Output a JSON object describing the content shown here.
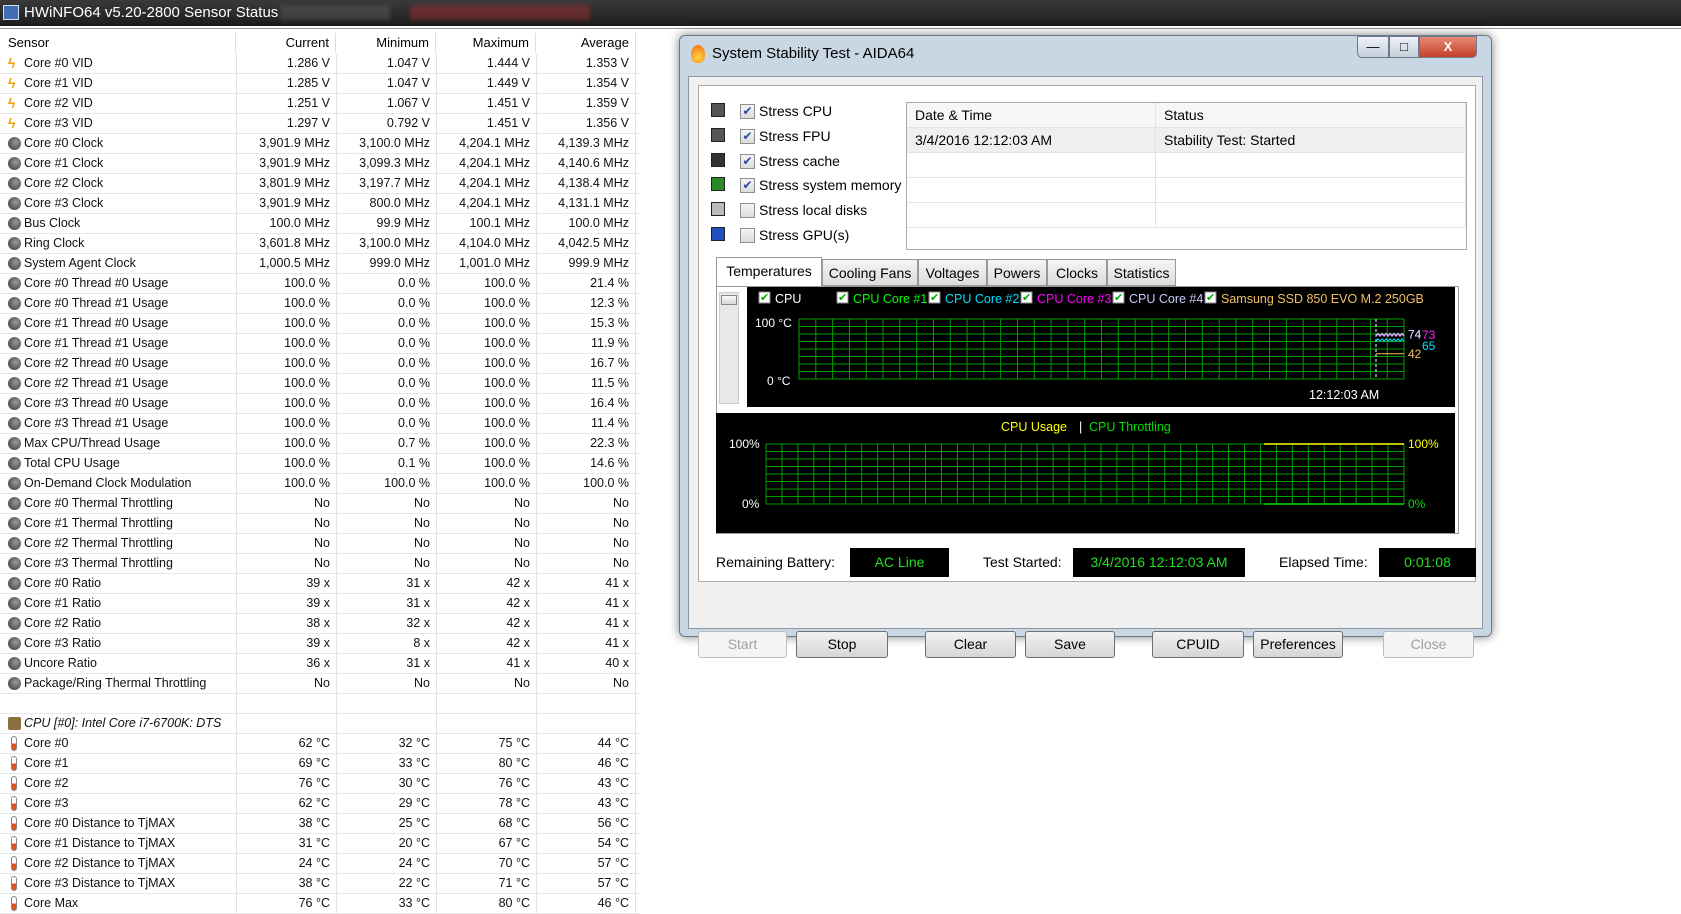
{
  "hwinfo": {
    "title": "HWiNFO64 v5.20-2800 Sensor Status",
    "columns": [
      "Sensor",
      "Current",
      "Minimum",
      "Maximum",
      "Average"
    ],
    "rows": [
      {
        "icon": "bolt",
        "name": "Core #0 VID",
        "v": [
          "1.286 V",
          "1.047 V",
          "1.444 V",
          "1.353 V"
        ]
      },
      {
        "icon": "bolt",
        "name": "Core #1 VID",
        "v": [
          "1.285 V",
          "1.047 V",
          "1.449 V",
          "1.354 V"
        ]
      },
      {
        "icon": "bolt",
        "name": "Core #2 VID",
        "v": [
          "1.251 V",
          "1.067 V",
          "1.451 V",
          "1.359 V"
        ]
      },
      {
        "icon": "bolt",
        "name": "Core #3 VID",
        "v": [
          "1.297 V",
          "0.792 V",
          "1.451 V",
          "1.356 V"
        ]
      },
      {
        "icon": "gauge",
        "name": "Core #0 Clock",
        "v": [
          "3,901.9 MHz",
          "3,100.0 MHz",
          "4,204.1 MHz",
          "4,139.3 MHz"
        ]
      },
      {
        "icon": "gauge",
        "name": "Core #1 Clock",
        "v": [
          "3,901.9 MHz",
          "3,099.3 MHz",
          "4,204.1 MHz",
          "4,140.6 MHz"
        ]
      },
      {
        "icon": "gauge",
        "name": "Core #2 Clock",
        "v": [
          "3,801.9 MHz",
          "3,197.7 MHz",
          "4,204.1 MHz",
          "4,138.4 MHz"
        ]
      },
      {
        "icon": "gauge",
        "name": "Core #3 Clock",
        "v": [
          "3,901.9 MHz",
          "800.0 MHz",
          "4,204.1 MHz",
          "4,131.1 MHz"
        ]
      },
      {
        "icon": "gauge",
        "name": "Bus Clock",
        "v": [
          "100.0 MHz",
          "99.9 MHz",
          "100.1 MHz",
          "100.0 MHz"
        ]
      },
      {
        "icon": "gauge",
        "name": "Ring Clock",
        "v": [
          "3,601.8 MHz",
          "3,100.0 MHz",
          "4,104.0 MHz",
          "4,042.5 MHz"
        ]
      },
      {
        "icon": "gauge",
        "name": "System Agent Clock",
        "v": [
          "1,000.5 MHz",
          "999.0 MHz",
          "1,001.0 MHz",
          "999.9 MHz"
        ]
      },
      {
        "icon": "gauge",
        "name": "Core #0 Thread #0 Usage",
        "v": [
          "100.0 %",
          "0.0 %",
          "100.0 %",
          "21.4 %"
        ]
      },
      {
        "icon": "gauge",
        "name": "Core #0 Thread #1 Usage",
        "v": [
          "100.0 %",
          "0.0 %",
          "100.0 %",
          "12.3 %"
        ]
      },
      {
        "icon": "gauge",
        "name": "Core #1 Thread #0 Usage",
        "v": [
          "100.0 %",
          "0.0 %",
          "100.0 %",
          "15.3 %"
        ]
      },
      {
        "icon": "gauge",
        "name": "Core #1 Thread #1 Usage",
        "v": [
          "100.0 %",
          "0.0 %",
          "100.0 %",
          "11.9 %"
        ]
      },
      {
        "icon": "gauge",
        "name": "Core #2 Thread #0 Usage",
        "v": [
          "100.0 %",
          "0.0 %",
          "100.0 %",
          "16.7 %"
        ]
      },
      {
        "icon": "gauge",
        "name": "Core #2 Thread #1 Usage",
        "v": [
          "100.0 %",
          "0.0 %",
          "100.0 %",
          "11.5 %"
        ]
      },
      {
        "icon": "gauge",
        "name": "Core #3 Thread #0 Usage",
        "v": [
          "100.0 %",
          "0.0 %",
          "100.0 %",
          "16.4 %"
        ]
      },
      {
        "icon": "gauge",
        "name": "Core #3 Thread #1 Usage",
        "v": [
          "100.0 %",
          "0.0 %",
          "100.0 %",
          "11.4 %"
        ]
      },
      {
        "icon": "gauge",
        "name": "Max CPU/Thread Usage",
        "v": [
          "100.0 %",
          "0.7 %",
          "100.0 %",
          "22.3 %"
        ]
      },
      {
        "icon": "gauge",
        "name": "Total CPU Usage",
        "v": [
          "100.0 %",
          "0.1 %",
          "100.0 %",
          "14.6 %"
        ]
      },
      {
        "icon": "gauge",
        "name": "On-Demand Clock Modulation",
        "v": [
          "100.0 %",
          "100.0 %",
          "100.0 %",
          "100.0 %"
        ]
      },
      {
        "icon": "gauge",
        "name": "Core #0 Thermal Throttling",
        "v": [
          "No",
          "No",
          "No",
          "No"
        ]
      },
      {
        "icon": "gauge",
        "name": "Core #1 Thermal Throttling",
        "v": [
          "No",
          "No",
          "No",
          "No"
        ]
      },
      {
        "icon": "gauge",
        "name": "Core #2 Thermal Throttling",
        "v": [
          "No",
          "No",
          "No",
          "No"
        ]
      },
      {
        "icon": "gauge",
        "name": "Core #3 Thermal Throttling",
        "v": [
          "No",
          "No",
          "No",
          "No"
        ]
      },
      {
        "icon": "gauge",
        "name": "Core #0 Ratio",
        "v": [
          "39 x",
          "31 x",
          "42 x",
          "41 x"
        ]
      },
      {
        "icon": "gauge",
        "name": "Core #1 Ratio",
        "v": [
          "39 x",
          "31 x",
          "42 x",
          "41 x"
        ]
      },
      {
        "icon": "gauge",
        "name": "Core #2 Ratio",
        "v": [
          "38 x",
          "32 x",
          "42 x",
          "41 x"
        ]
      },
      {
        "icon": "gauge",
        "name": "Core #3 Ratio",
        "v": [
          "39 x",
          "8 x",
          "42 x",
          "41 x"
        ]
      },
      {
        "icon": "gauge",
        "name": "Uncore Ratio",
        "v": [
          "36 x",
          "31 x",
          "41 x",
          "40 x"
        ]
      },
      {
        "icon": "gauge",
        "name": "Package/Ring Thermal Throttling",
        "v": [
          "No",
          "No",
          "No",
          "No"
        ]
      },
      {
        "icon": "blank",
        "name": "",
        "v": [
          "",
          "",
          "",
          ""
        ]
      },
      {
        "icon": "cpu",
        "name": "CPU [#0]: Intel Core i7-6700K: DTS",
        "v": [
          "",
          "",
          "",
          ""
        ]
      },
      {
        "icon": "thermo",
        "name": "Core #0",
        "v": [
          "62 °C",
          "32 °C",
          "75 °C",
          "44 °C"
        ]
      },
      {
        "icon": "thermo",
        "name": "Core #1",
        "v": [
          "69 °C",
          "33 °C",
          "80 °C",
          "46 °C"
        ]
      },
      {
        "icon": "thermo",
        "name": "Core #2",
        "v": [
          "76 °C",
          "30 °C",
          "76 °C",
          "43 °C"
        ]
      },
      {
        "icon": "thermo",
        "name": "Core #3",
        "v": [
          "62 °C",
          "29 °C",
          "78 °C",
          "43 °C"
        ]
      },
      {
        "icon": "thermo",
        "name": "Core #0 Distance to TjMAX",
        "v": [
          "38 °C",
          "25 °C",
          "68 °C",
          "56 °C"
        ]
      },
      {
        "icon": "thermo",
        "name": "Core #1 Distance to TjMAX",
        "v": [
          "31 °C",
          "20 °C",
          "67 °C",
          "54 °C"
        ]
      },
      {
        "icon": "thermo",
        "name": "Core #2 Distance to TjMAX",
        "v": [
          "24 °C",
          "24 °C",
          "70 °C",
          "57 °C"
        ]
      },
      {
        "icon": "thermo",
        "name": "Core #3 Distance to TjMAX",
        "v": [
          "38 °C",
          "22 °C",
          "71 °C",
          "57 °C"
        ]
      },
      {
        "icon": "thermo",
        "name": "Core Max",
        "v": [
          "76 °C",
          "33 °C",
          "80 °C",
          "46 °C"
        ]
      }
    ]
  },
  "aida": {
    "title": "System Stability Test - AIDA64",
    "window_buttons": {
      "minimize": "—",
      "maximize": "□",
      "close": "X"
    },
    "stress": [
      {
        "label": "Stress CPU",
        "checked": true,
        "icon": "cpu-chip-icon"
      },
      {
        "label": "Stress FPU",
        "checked": true,
        "icon": "fpu-chip-icon"
      },
      {
        "label": "Stress cache",
        "checked": true,
        "icon": "cache-chip-icon"
      },
      {
        "label": "Stress system memory",
        "checked": true,
        "icon": "memory-module-icon"
      },
      {
        "label": "Stress local disks",
        "checked": false,
        "icon": "disk-drive-icon"
      },
      {
        "label": "Stress GPU(s)",
        "checked": false,
        "icon": "gpu-monitor-icon"
      }
    ],
    "log": {
      "columns": [
        "Date & Time",
        "Status"
      ],
      "rows": [
        [
          "3/4/2016 12:12:03 AM",
          "Stability Test: Started"
        ]
      ]
    },
    "tabs": [
      "Temperatures",
      "Cooling Fans",
      "Voltages",
      "Powers",
      "Clocks",
      "Statistics"
    ],
    "active_tab": "Temperatures",
    "check_mark": "✔",
    "bottom": {
      "battery_label": "Remaining Battery:",
      "battery": "AC Line",
      "started_label": "Test Started:",
      "started": "3/4/2016 12:12:03 AM",
      "elapsed_label": "Elapsed Time:",
      "elapsed": "0:01:08"
    },
    "buttons": [
      {
        "label": "Start",
        "enabled": false
      },
      {
        "label": "Stop",
        "enabled": true
      },
      {
        "label": "Clear",
        "enabled": true
      },
      {
        "label": "Save",
        "enabled": true
      },
      {
        "label": "CPUID",
        "enabled": true
      },
      {
        "label": "Preferences",
        "enabled": true
      },
      {
        "label": "Close",
        "enabled": false
      }
    ]
  },
  "chart_data": [
    {
      "type": "line",
      "title": "",
      "ylim": [
        0,
        100
      ],
      "ymax_label": "100 °C",
      "ymin_label": "0 °C",
      "time_label": "12:12:03 AM",
      "grid": true,
      "series": [
        {
          "name": "CPU",
          "color": "#ffffff",
          "last": "74"
        },
        {
          "name": "CPU Core #1",
          "color": "#00ff00",
          "last": "73"
        },
        {
          "name": "CPU Core #2",
          "color": "#00e0ff",
          "last": "65"
        },
        {
          "name": "CPU Core #3",
          "color": "#ff00ff",
          "last": "73"
        },
        {
          "name": "CPU Core #4",
          "color": "#c8c8ff",
          "last": "74"
        },
        {
          "name": "Samsung SSD 850 EVO M.2 250GB",
          "color": "#f0c060",
          "last": "42"
        }
      ]
    },
    {
      "type": "line",
      "title": "",
      "ylim": [
        0,
        100
      ],
      "ymax_label": "100%",
      "ymin_label": "0%",
      "grid": true,
      "separator": "|",
      "series": [
        {
          "name": "CPU Usage",
          "color": "#ffff00",
          "value": 100,
          "label": "100%"
        },
        {
          "name": "CPU Throttling",
          "color": "#00e000",
          "value": 0,
          "label": "0%"
        }
      ]
    }
  ]
}
